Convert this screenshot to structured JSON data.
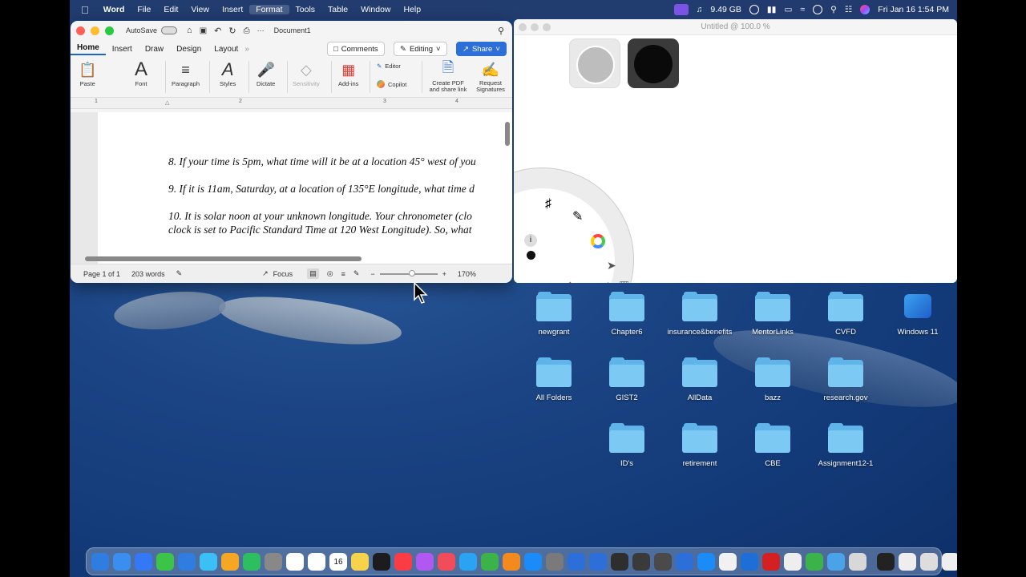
{
  "menubar": {
    "app": "Word",
    "items": [
      "File",
      "Edit",
      "View",
      "Insert",
      "Format",
      "Tools",
      "Table",
      "Window",
      "Help"
    ],
    "storage": "9.49 GB",
    "datetime": "Fri Jan 16  1:54 PM"
  },
  "word": {
    "autosave": "AutoSave",
    "doc_title": "Document1",
    "tabs": [
      "Home",
      "Insert",
      "Draw",
      "Design",
      "Layout"
    ],
    "comments_label": "Comments",
    "editing_label": "Editing",
    "share_label": "Share",
    "ribbon": {
      "paste": "Paste",
      "font": "Font",
      "paragraph": "Paragraph",
      "styles": "Styles",
      "dictate": "Dictate",
      "sensitivity": "Sensitivity",
      "addins": "Add-ins",
      "editor": "Editor",
      "copilot": "Copilot",
      "create_pdf": "Create PDF and share link",
      "request_sig": "Request Signatures"
    },
    "ruler_marks": [
      "1",
      "2",
      "3",
      "4"
    ],
    "lines": [
      "8. If your time is 5pm, what time will it be at a location 45° west of you",
      "9. If it is 11am, Saturday, at a location of 135°E longitude, what time d",
      "10. It is solar noon at your unknown longitude. Your chronometer (clo",
      "clock is set to Pacific Standard Time at 120 West Longitude). So, what"
    ],
    "status": {
      "page": "Page 1 of 1",
      "words": "203 words",
      "focus": "Focus",
      "zoom": "170%"
    }
  },
  "paint": {
    "title": "Untitled @ 100.0 %",
    "colors": {
      "gray": "#bdbdbd",
      "black": "#0a0a0a",
      "undo": "#d9413a"
    }
  },
  "desktop": {
    "folders": [
      {
        "label": "newgrant"
      },
      {
        "label": "Chapter6"
      },
      {
        "label": "insurance&benefits"
      },
      {
        "label": "MentorLinks"
      },
      {
        "label": "CVFD"
      },
      {
        "label": "Windows 11"
      },
      {
        "label": "All Folders"
      },
      {
        "label": "GIST2"
      },
      {
        "label": "AllData"
      },
      {
        "label": "bazz"
      },
      {
        "label": "research.gov"
      },
      {
        "label": "ID's"
      },
      {
        "label": "retirement"
      },
      {
        "label": "CBE"
      },
      {
        "label": "Assignment12-1"
      }
    ]
  },
  "dock": {
    "calendar_day": "16",
    "icon_colors": [
      "#2f7de1",
      "#3a8ef0",
      "#3478f6",
      "#3bc447",
      "#2f7de1",
      "#3ac0f5",
      "#f5a623",
      "#2dbe60",
      "#888888",
      "#ffffff",
      "#fefefe",
      "#ffffff",
      "#f6d34a",
      "#1c1c1e",
      "#fc3c44",
      "#b058f0",
      "#f04c5c",
      "#2aa3f2",
      "#3bb34a",
      "#f28a1e",
      "#1b8cf7",
      "#7a7a7a",
      "#2d6fd9",
      "#2d6fd9",
      "#2e2e2e",
      "#3a3a3a",
      "#4a4a4a",
      "#2d6fd9",
      "#1b8cf7",
      "#f1f1f1",
      "#1e6ed8",
      "#d42020",
      "#eeeeee",
      "#3bb34a",
      "#4aa3e8",
      "#d8d8d8",
      "#222222",
      "#eeeeee",
      "#dddddd",
      "#eeeeee",
      "#bbbbbb"
    ]
  }
}
